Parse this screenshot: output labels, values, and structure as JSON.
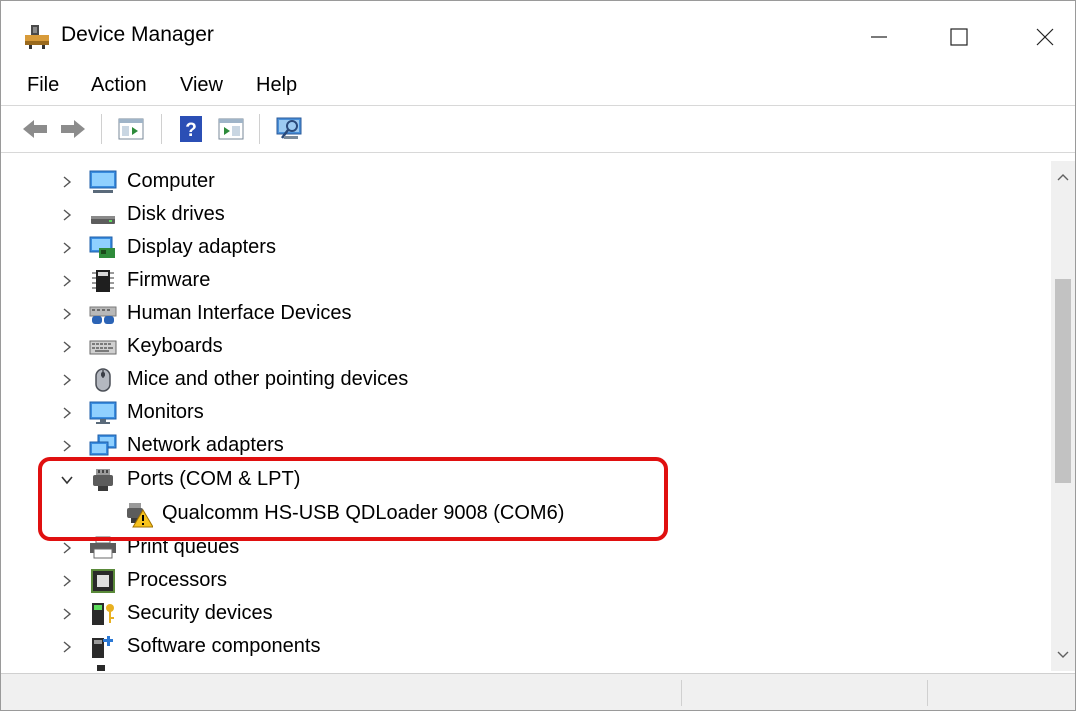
{
  "window": {
    "title": "Device Manager"
  },
  "title_controls": {
    "minimize": "—",
    "maximize": "☐",
    "close": "✕"
  },
  "menu": [
    {
      "label": "File"
    },
    {
      "label": "Action"
    },
    {
      "label": "View"
    },
    {
      "label": "Help"
    }
  ],
  "toolbar": {
    "back_icon": "back-arrow-icon",
    "forward_icon": "forward-arrow-icon",
    "properties_icon": "properties-pane-icon",
    "help_icon": "help-icon",
    "update_icon": "update-driver-icon",
    "scan_icon": "scan-hardware-icon"
  },
  "tree": {
    "items": [
      {
        "label": "Computer",
        "icon": "computer-icon",
        "expanded": false
      },
      {
        "label": "Disk drives",
        "icon": "disk-drive-icon",
        "expanded": false
      },
      {
        "label": "Display adapters",
        "icon": "display-adapter-icon",
        "expanded": false
      },
      {
        "label": "Firmware",
        "icon": "firmware-icon",
        "expanded": false
      },
      {
        "label": "Human Interface Devices",
        "icon": "hid-icon",
        "expanded": false
      },
      {
        "label": "Keyboards",
        "icon": "keyboard-icon",
        "expanded": false
      },
      {
        "label": "Mice and other pointing devices",
        "icon": "mouse-icon",
        "expanded": false
      },
      {
        "label": "Monitors",
        "icon": "monitor-icon",
        "expanded": false
      },
      {
        "label": "Network adapters",
        "icon": "network-adapter-icon",
        "expanded": false
      },
      {
        "label": "Ports (COM & LPT)",
        "icon": "port-icon",
        "expanded": true
      },
      {
        "label": "Qualcomm HS-USB QDLoader 9008 (COM6)",
        "icon": "warning-port-icon",
        "child": true
      },
      {
        "label": "Print queues",
        "icon": "printer-icon",
        "expanded": false
      },
      {
        "label": "Processors",
        "icon": "processor-icon",
        "expanded": false
      },
      {
        "label": "Security devices",
        "icon": "security-device-icon",
        "expanded": false
      },
      {
        "label": "Software components",
        "icon": "software-component-icon",
        "expanded": false
      }
    ]
  },
  "colors": {
    "highlight": "#e01010",
    "accent": "#2b78d4"
  }
}
